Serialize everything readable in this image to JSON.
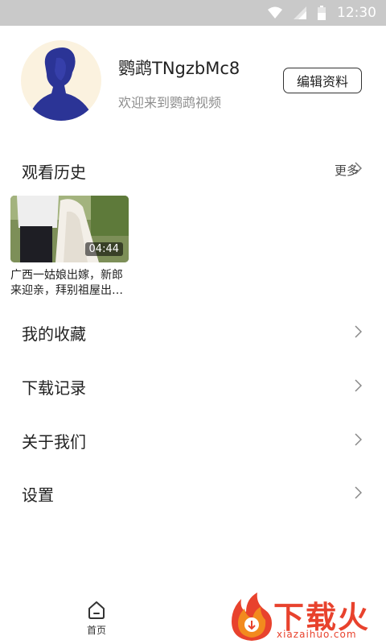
{
  "status_bar": {
    "time": "12:30",
    "icons": [
      "wifi-icon",
      "signal-icon",
      "battery-icon"
    ]
  },
  "profile": {
    "username": "鹦鹉TNgzbMc8",
    "welcome": "欢迎来到鹦鹉视频",
    "edit_label": "编辑资料"
  },
  "history": {
    "title": "观看历史",
    "more_label": "更多",
    "items": [
      {
        "duration": "04:44",
        "title": "广西一姑娘出嫁，新郎来迎亲，拜别祖屋出…"
      }
    ]
  },
  "menu": [
    {
      "label": "我的收藏"
    },
    {
      "label": "下载记录"
    },
    {
      "label": "关于我们"
    },
    {
      "label": "设置"
    }
  ],
  "bottom_nav": {
    "home_label": "首页"
  },
  "watermark": {
    "text": "下载火",
    "url": "xiazaihuo.com"
  },
  "colors": {
    "accent": "#e8422d",
    "status_bar": "#c9c9c9",
    "avatar_bg": "#fbf2df",
    "avatar_figure": "#2b3496"
  }
}
